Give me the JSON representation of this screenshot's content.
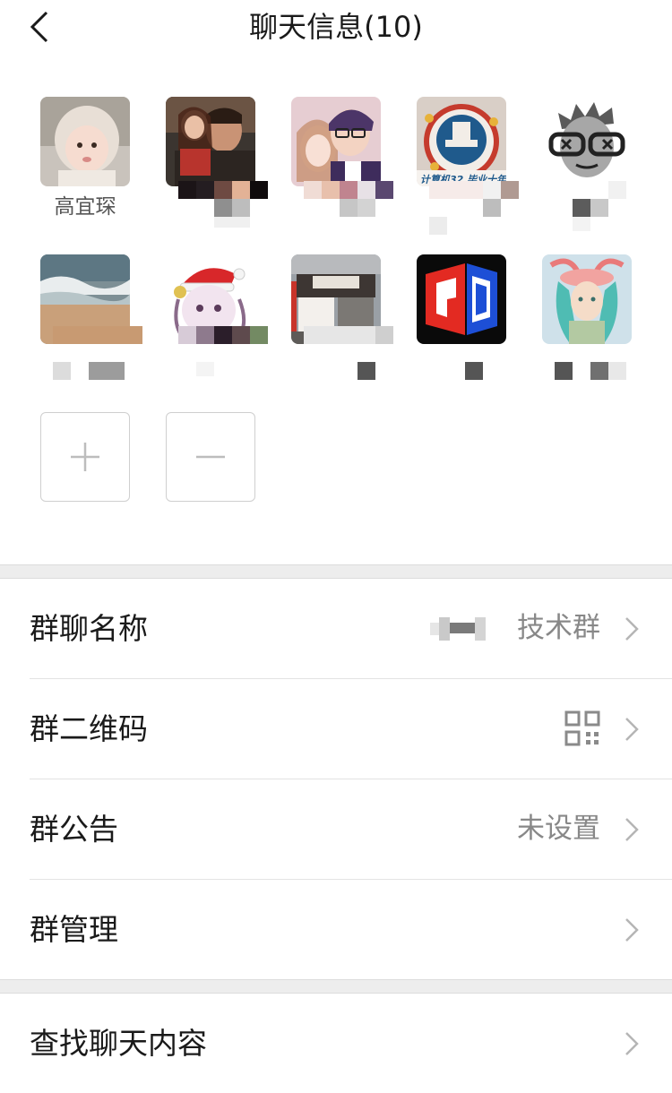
{
  "navbar": {
    "title": "聊天信息(10)",
    "back_icon": "chevron-left-icon"
  },
  "members": [
    {
      "name": "高宜琛",
      "avatar": "baby-in-knit-hat"
    },
    {
      "name": "",
      "avatar": "man-and-girl-photo"
    },
    {
      "name": "",
      "avatar": "couple-selfie"
    },
    {
      "name": "",
      "avatar": "school-badge-cake"
    },
    {
      "name": "",
      "avatar": "cartoon-nerd-glasses"
    },
    {
      "name": "",
      "avatar": "beach-waves"
    },
    {
      "name": "",
      "avatar": "anime-santa-hat"
    },
    {
      "name": "",
      "avatar": "storefront-photo"
    },
    {
      "name": "",
      "avatar": "red-blue-logo"
    },
    {
      "name": "",
      "avatar": "fantasy-character"
    }
  ],
  "actions": {
    "add_icon": "plus-icon",
    "remove_icon": "minus-icon"
  },
  "settings": {
    "group_name_label": "群聊名称",
    "group_name_value": "技术群",
    "qr_label": "群二维码",
    "qr_icon": "qr-code-icon",
    "notice_label": "群公告",
    "notice_value": "未设置",
    "manage_label": "群管理",
    "search_label": "查找聊天内容"
  },
  "colors": {
    "background": "#ffffff",
    "section_gap": "#ededed",
    "secondary_text": "#888888"
  }
}
